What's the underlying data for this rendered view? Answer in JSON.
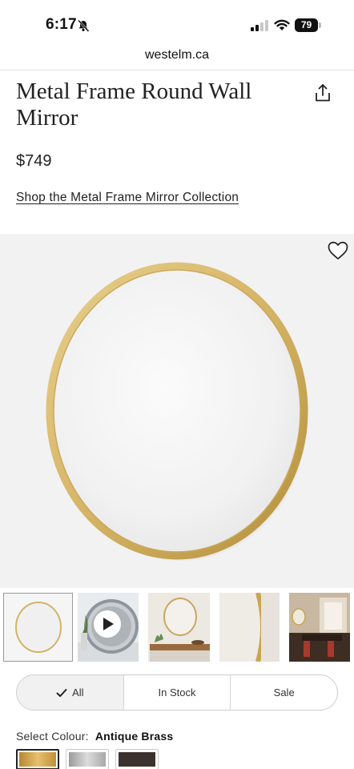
{
  "status_bar": {
    "time": "6:17",
    "battery": "79"
  },
  "browser": {
    "url": "westelm.ca"
  },
  "product": {
    "title": "Metal Frame Round Wall Mirror",
    "price": "$749",
    "collection_link": "Shop the Metal Frame Mirror Collection"
  },
  "filters": [
    "All",
    "In Stock",
    "Sale"
  ],
  "colour": {
    "label": "Select Colour:",
    "selected": "Antique Brass"
  },
  "colors": {
    "brass": "#d6b56a",
    "frame_light": "#f3e2b0",
    "hero_bg": "#f2f2f2"
  },
  "icons": [
    "mute-bell-icon",
    "signal-icon",
    "wifi-icon",
    "battery-icon",
    "share-icon",
    "heart-icon",
    "play-icon",
    "checkmark-icon"
  ]
}
